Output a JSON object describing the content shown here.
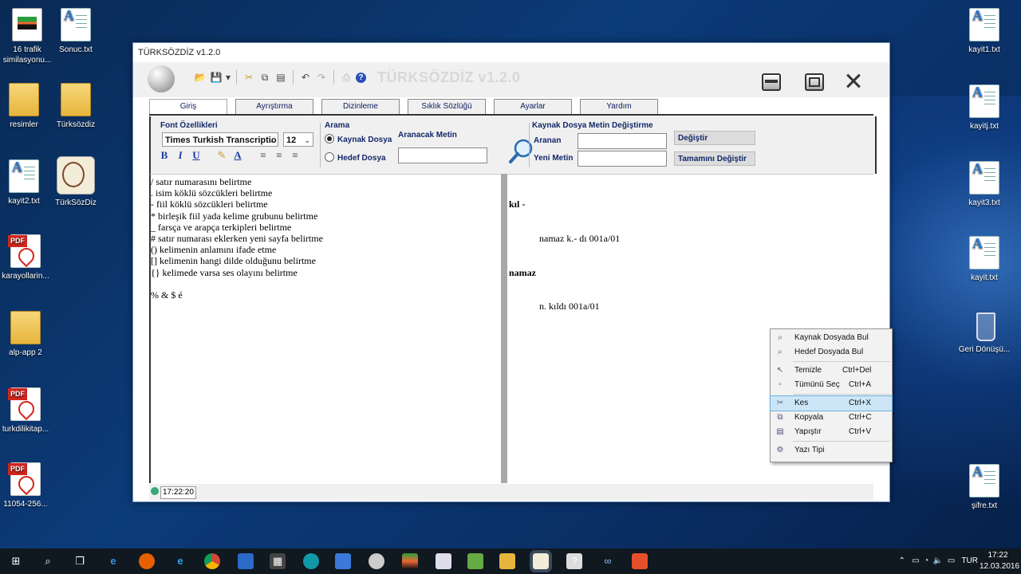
{
  "desktop": {
    "left_icons": [
      {
        "label": "16  trafik similasyonu...",
        "kind": "img"
      },
      {
        "label": "resimler",
        "kind": "folder"
      },
      {
        "label": "kayit2.txt",
        "kind": "txt"
      },
      {
        "label": "karayollarin...",
        "kind": "pdf"
      },
      {
        "label": "alp-app 2",
        "kind": "folder"
      },
      {
        "label": "turkdilikitap...",
        "kind": "pdf"
      },
      {
        "label": "11054-256...",
        "kind": "pdf"
      }
    ],
    "second_col_icons": [
      {
        "label": "Sonuc.txt",
        "kind": "txt"
      },
      {
        "label": "Türksözdiz",
        "kind": "folder"
      },
      {
        "label": "TürkSözDiz",
        "kind": "round"
      }
    ],
    "right_icons": [
      {
        "label": "kayit1.txt",
        "kind": "txt"
      },
      {
        "label": "kayitj.txt",
        "kind": "txt"
      },
      {
        "label": "kayit3.txt",
        "kind": "txt"
      },
      {
        "label": "kayit.txt",
        "kind": "txt"
      },
      {
        "label": "Geri Dönüşü...",
        "kind": "bin"
      },
      {
        "label": "şifre.txt",
        "kind": "txt"
      }
    ]
  },
  "window": {
    "title": "TÜRKSÖZDİZ v1.2.0",
    "big_title": "TÜRKSÖZDİZ v1.2.0",
    "tabs": [
      "Giriş",
      "Ayrıştırma",
      "Dizinleme",
      "Sıklık Sözlüğü",
      "Ayarlar",
      "Yardım"
    ],
    "active_tab": "Giriş"
  },
  "ribbon": {
    "font_group_label": "Font Özellikleri",
    "font_name": "Times Turkish Transcriptio",
    "font_size": "12",
    "search_group_label": "Arama",
    "radio_source": "Kaynak Dosya",
    "radio_target": "Hedef Dosya",
    "search_text_label": "Aranacak Metin",
    "search_value": "",
    "replace_group_label": "Kaynak Dosya Metin Değiştirme",
    "aranan_label": "Aranan",
    "yeni_label": "Yeni Metin",
    "aranan_value": "",
    "yeni_value": "",
    "replace_button": "Değiştir",
    "replace_all_button": "Tamamını Değiştir"
  },
  "editor_left": {
    "lines": [
      "/ satır numarasını belirtme",
      ". isim köklü sözcükleri belirtme",
      "- fiil köklü sözcükleri belirtme",
      "* birleşik fiil yada kelime grubunu belirtme",
      "_ farsça ve arapça terkipleri belirtme",
      "# satır numarası eklerken yeni sayfa belirtme",
      "() kelimenin anlamını ifade etme",
      "[] kelimenin hangi dilde olduğunu belirtme",
      "{} kelimede varsa ses olayını belirtme",
      "",
      "% & $ é"
    ]
  },
  "editor_right": {
    "entries": [
      {
        "head": "kıl -",
        "detail": "namaz k.- dı 001a/01"
      },
      {
        "head": "namaz",
        "detail": "n. kıldı 001a/01"
      }
    ]
  },
  "status": {
    "time": "17:22:20"
  },
  "context_menu": {
    "items": [
      {
        "label": "Kaynak Dosyada Bul",
        "shortcut": "",
        "icon": "search-icon"
      },
      {
        "label": "Hedef Dosyada Bul",
        "shortcut": "",
        "icon": "search-icon"
      },
      {
        "label": "Temizle",
        "shortcut": "Ctrl+Del",
        "icon": "clear-icon"
      },
      {
        "label": "Tümünü Seç",
        "shortcut": "Ctrl+A",
        "icon": "select-all-icon"
      },
      {
        "label": "Kes",
        "shortcut": "Ctrl+X",
        "icon": "cut-icon"
      },
      {
        "label": "Kopyala",
        "shortcut": "Ctrl+C",
        "icon": "copy-icon"
      },
      {
        "label": "Yapıştır",
        "shortcut": "Ctrl+V",
        "icon": "paste-icon"
      },
      {
        "label": "Yazı Tipi",
        "shortcut": "",
        "icon": "font-icon"
      }
    ],
    "highlighted": "Kes"
  },
  "taskbar": {
    "language": "TUR",
    "time": "17:22",
    "date": "12.03.2016"
  },
  "colors": {
    "accent": "#14286a",
    "desktop": "#0b3b78"
  }
}
